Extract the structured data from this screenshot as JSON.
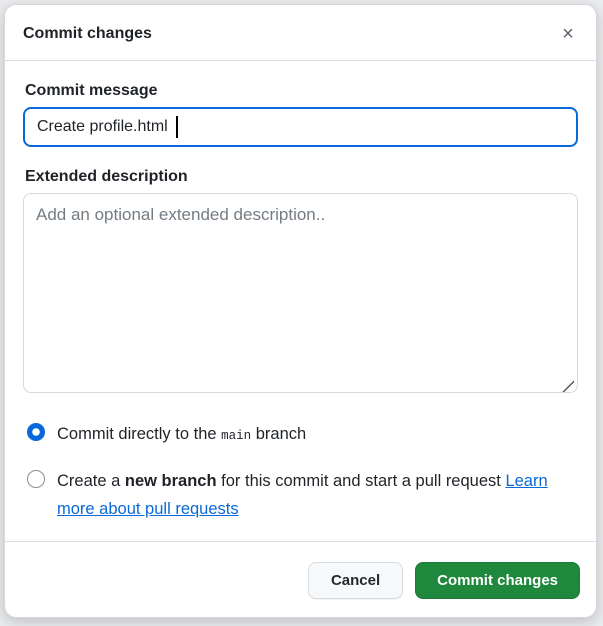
{
  "dialog": {
    "title": "Commit changes",
    "close_icon": "×"
  },
  "form": {
    "commit_message": {
      "label": "Commit message",
      "value": "Create profile.html"
    },
    "extended_description": {
      "label": "Extended description",
      "placeholder": "Add an optional extended description.."
    }
  },
  "options": {
    "direct": {
      "selected": "true",
      "prefix": "Commit directly to the ",
      "branch": "main",
      "suffix": " branch"
    },
    "new_branch": {
      "selected": "false",
      "prefix": "Create a ",
      "bold": "new branch",
      "suffix": " for this commit and start a pull request ",
      "link": "Learn more about pull requests"
    }
  },
  "footer": {
    "cancel_label": "Cancel",
    "submit_label": "Commit changes"
  },
  "colors": {
    "accent_blue": "#0969da",
    "button_green": "#1f883d",
    "link_blue": "#0969da",
    "divider": "#d9dee3"
  }
}
